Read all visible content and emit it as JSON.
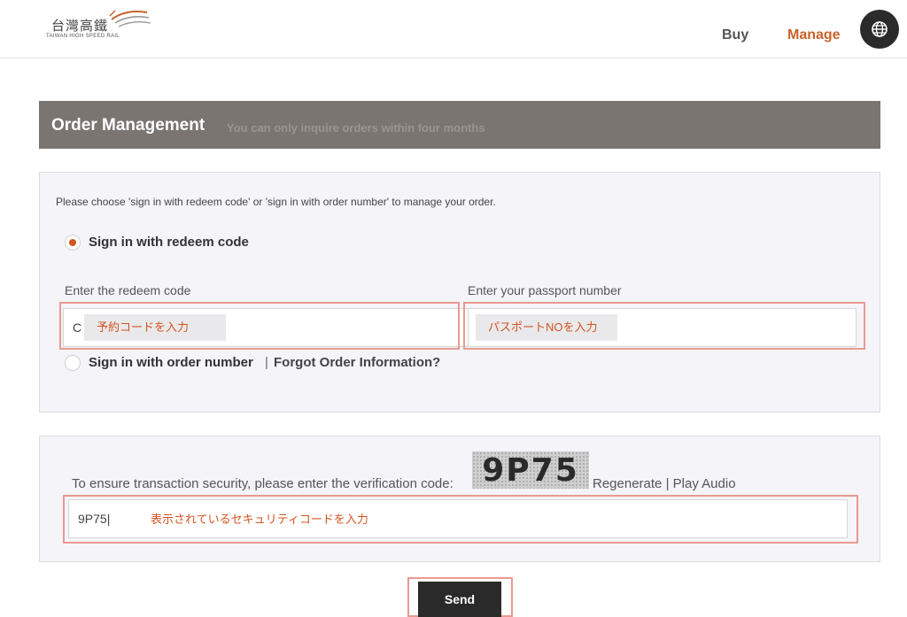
{
  "header": {
    "logo_cn": "台灣高鐵",
    "logo_en": "TAIWAN HIGH SPEED RAIL",
    "nav": {
      "buy": "Buy",
      "manage": "Manage"
    },
    "globe_icon": "globe-icon"
  },
  "title_bar": {
    "title": "Order Management",
    "subtitle": "You can only inquire orders within four months"
  },
  "sign_in": {
    "instruction": "Please choose 'sign in with redeem code' or 'sign in with order number' to manage your order.",
    "redeem_option": {
      "label": "Sign in with redeem code",
      "selected": true
    },
    "redeem_code": {
      "label": "Enter the redeem code",
      "value": "C",
      "hint": "予約コードを入力"
    },
    "passport": {
      "label": "Enter your passport number",
      "value": "",
      "hint": "パスポートNOを入力"
    },
    "order_option": {
      "label": "Sign in with order number",
      "selected": false
    },
    "separator": "|",
    "forgot_link": "Forgot Order Information?"
  },
  "verification": {
    "text": "To ensure transaction security, please enter the verification code:",
    "captcha": "9P75",
    "regenerate": "Regenerate",
    "separator": "|",
    "play_audio": "Play Audio",
    "input_value": "9P75|",
    "hint": "表示されているセキュリティコードを入力"
  },
  "send_label": "Send",
  "colors": {
    "accent": "#c8622a",
    "title_bar": "#7a7571",
    "highlight": "#e89a91",
    "button": "#2a2a2a"
  }
}
